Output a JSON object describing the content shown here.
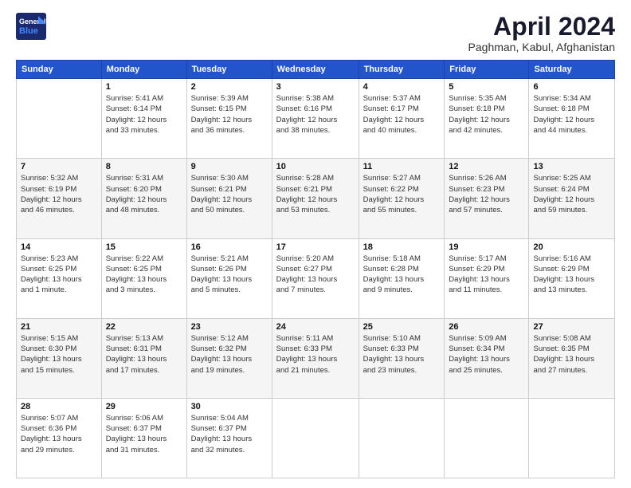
{
  "header": {
    "logo_general": "General",
    "logo_blue": "Blue",
    "title": "April 2024",
    "location": "Paghman, Kabul, Afghanistan"
  },
  "weekdays": [
    "Sunday",
    "Monday",
    "Tuesday",
    "Wednesday",
    "Thursday",
    "Friday",
    "Saturday"
  ],
  "weeks": [
    [
      {
        "day": "",
        "info": ""
      },
      {
        "day": "1",
        "info": "Sunrise: 5:41 AM\nSunset: 6:14 PM\nDaylight: 12 hours\nand 33 minutes."
      },
      {
        "day": "2",
        "info": "Sunrise: 5:39 AM\nSunset: 6:15 PM\nDaylight: 12 hours\nand 36 minutes."
      },
      {
        "day": "3",
        "info": "Sunrise: 5:38 AM\nSunset: 6:16 PM\nDaylight: 12 hours\nand 38 minutes."
      },
      {
        "day": "4",
        "info": "Sunrise: 5:37 AM\nSunset: 6:17 PM\nDaylight: 12 hours\nand 40 minutes."
      },
      {
        "day": "5",
        "info": "Sunrise: 5:35 AM\nSunset: 6:18 PM\nDaylight: 12 hours\nand 42 minutes."
      },
      {
        "day": "6",
        "info": "Sunrise: 5:34 AM\nSunset: 6:18 PM\nDaylight: 12 hours\nand 44 minutes."
      }
    ],
    [
      {
        "day": "7",
        "info": "Sunrise: 5:32 AM\nSunset: 6:19 PM\nDaylight: 12 hours\nand 46 minutes."
      },
      {
        "day": "8",
        "info": "Sunrise: 5:31 AM\nSunset: 6:20 PM\nDaylight: 12 hours\nand 48 minutes."
      },
      {
        "day": "9",
        "info": "Sunrise: 5:30 AM\nSunset: 6:21 PM\nDaylight: 12 hours\nand 50 minutes."
      },
      {
        "day": "10",
        "info": "Sunrise: 5:28 AM\nSunset: 6:21 PM\nDaylight: 12 hours\nand 53 minutes."
      },
      {
        "day": "11",
        "info": "Sunrise: 5:27 AM\nSunset: 6:22 PM\nDaylight: 12 hours\nand 55 minutes."
      },
      {
        "day": "12",
        "info": "Sunrise: 5:26 AM\nSunset: 6:23 PM\nDaylight: 12 hours\nand 57 minutes."
      },
      {
        "day": "13",
        "info": "Sunrise: 5:25 AM\nSunset: 6:24 PM\nDaylight: 12 hours\nand 59 minutes."
      }
    ],
    [
      {
        "day": "14",
        "info": "Sunrise: 5:23 AM\nSunset: 6:25 PM\nDaylight: 13 hours\nand 1 minute."
      },
      {
        "day": "15",
        "info": "Sunrise: 5:22 AM\nSunset: 6:25 PM\nDaylight: 13 hours\nand 3 minutes."
      },
      {
        "day": "16",
        "info": "Sunrise: 5:21 AM\nSunset: 6:26 PM\nDaylight: 13 hours\nand 5 minutes."
      },
      {
        "day": "17",
        "info": "Sunrise: 5:20 AM\nSunset: 6:27 PM\nDaylight: 13 hours\nand 7 minutes."
      },
      {
        "day": "18",
        "info": "Sunrise: 5:18 AM\nSunset: 6:28 PM\nDaylight: 13 hours\nand 9 minutes."
      },
      {
        "day": "19",
        "info": "Sunrise: 5:17 AM\nSunset: 6:29 PM\nDaylight: 13 hours\nand 11 minutes."
      },
      {
        "day": "20",
        "info": "Sunrise: 5:16 AM\nSunset: 6:29 PM\nDaylight: 13 hours\nand 13 minutes."
      }
    ],
    [
      {
        "day": "21",
        "info": "Sunrise: 5:15 AM\nSunset: 6:30 PM\nDaylight: 13 hours\nand 15 minutes."
      },
      {
        "day": "22",
        "info": "Sunrise: 5:13 AM\nSunset: 6:31 PM\nDaylight: 13 hours\nand 17 minutes."
      },
      {
        "day": "23",
        "info": "Sunrise: 5:12 AM\nSunset: 6:32 PM\nDaylight: 13 hours\nand 19 minutes."
      },
      {
        "day": "24",
        "info": "Sunrise: 5:11 AM\nSunset: 6:33 PM\nDaylight: 13 hours\nand 21 minutes."
      },
      {
        "day": "25",
        "info": "Sunrise: 5:10 AM\nSunset: 6:33 PM\nDaylight: 13 hours\nand 23 minutes."
      },
      {
        "day": "26",
        "info": "Sunrise: 5:09 AM\nSunset: 6:34 PM\nDaylight: 13 hours\nand 25 minutes."
      },
      {
        "day": "27",
        "info": "Sunrise: 5:08 AM\nSunset: 6:35 PM\nDaylight: 13 hours\nand 27 minutes."
      }
    ],
    [
      {
        "day": "28",
        "info": "Sunrise: 5:07 AM\nSunset: 6:36 PM\nDaylight: 13 hours\nand 29 minutes."
      },
      {
        "day": "29",
        "info": "Sunrise: 5:06 AM\nSunset: 6:37 PM\nDaylight: 13 hours\nand 31 minutes."
      },
      {
        "day": "30",
        "info": "Sunrise: 5:04 AM\nSunset: 6:37 PM\nDaylight: 13 hours\nand 32 minutes."
      },
      {
        "day": "",
        "info": ""
      },
      {
        "day": "",
        "info": ""
      },
      {
        "day": "",
        "info": ""
      },
      {
        "day": "",
        "info": ""
      }
    ]
  ]
}
